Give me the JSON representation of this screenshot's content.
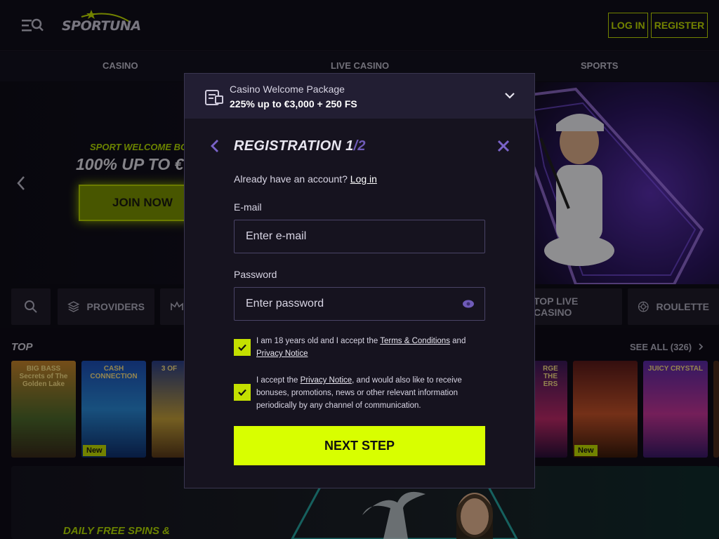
{
  "header": {
    "logo_text": "SPORTUNA",
    "login_label": "LOG IN",
    "register_label": "REGISTER"
  },
  "nav": [
    "CASINO",
    "LIVE CASINO",
    "SPORTS"
  ],
  "hero": {
    "tagline": "SPORT WELCOME BO",
    "title": "100% UP TO €",
    "cta_label": "JOIN NOW"
  },
  "categories": [
    "PROVIDERS",
    "TOP LIVE CASINO",
    "ROULETTE"
  ],
  "top_games": {
    "label": "TOP",
    "see_all": "SEE ALL (326)",
    "tiles": [
      {
        "title": "BIG BASS Secrets of The Golden Lake",
        "badge": ""
      },
      {
        "title": "CASH CONNECTION",
        "badge": "New"
      },
      {
        "title": "3 OF",
        "badge": ""
      },
      {
        "title": "RGE THE ERS",
        "badge": ""
      },
      {
        "title": "",
        "badge": "New"
      },
      {
        "title": "JUICY CRYSTAL",
        "badge": ""
      }
    ],
    "new_badge": "New"
  },
  "promo": {
    "title": "DAILY FREE SPINS &"
  },
  "modal": {
    "welcome_title": "Casino Welcome Package",
    "welcome_offer": "225% up to €3,000 + 250 FS",
    "registration_title": "REGISTRATION 1",
    "registration_step_total": "/2",
    "already_text": "Already have an account?",
    "login_link": "Log in",
    "email_label": "E-mail",
    "email_placeholder": "Enter e-mail",
    "password_label": "Password",
    "password_placeholder": "Enter password",
    "consent_1": {
      "pre": "I am 18 years old and I accept the ",
      "terms": "Terms & Conditions",
      "and": " and ",
      "privacy": "Privacy Notice",
      "checked": true
    },
    "consent_2": {
      "pre": "I accept the ",
      "privacy": "Privacy Notice",
      "post": ", and would also like to receive bonuses, promotions, news or other relevant information periodically by any channel of communication.",
      "checked": true
    },
    "next_label": "NEXT STEP"
  },
  "colors": {
    "accent": "#d8ff00",
    "outline_accent": "#c4e000",
    "modal_bg": "#16131f",
    "modal_header_bg": "#221e33",
    "purple": "#6f5bb8"
  }
}
